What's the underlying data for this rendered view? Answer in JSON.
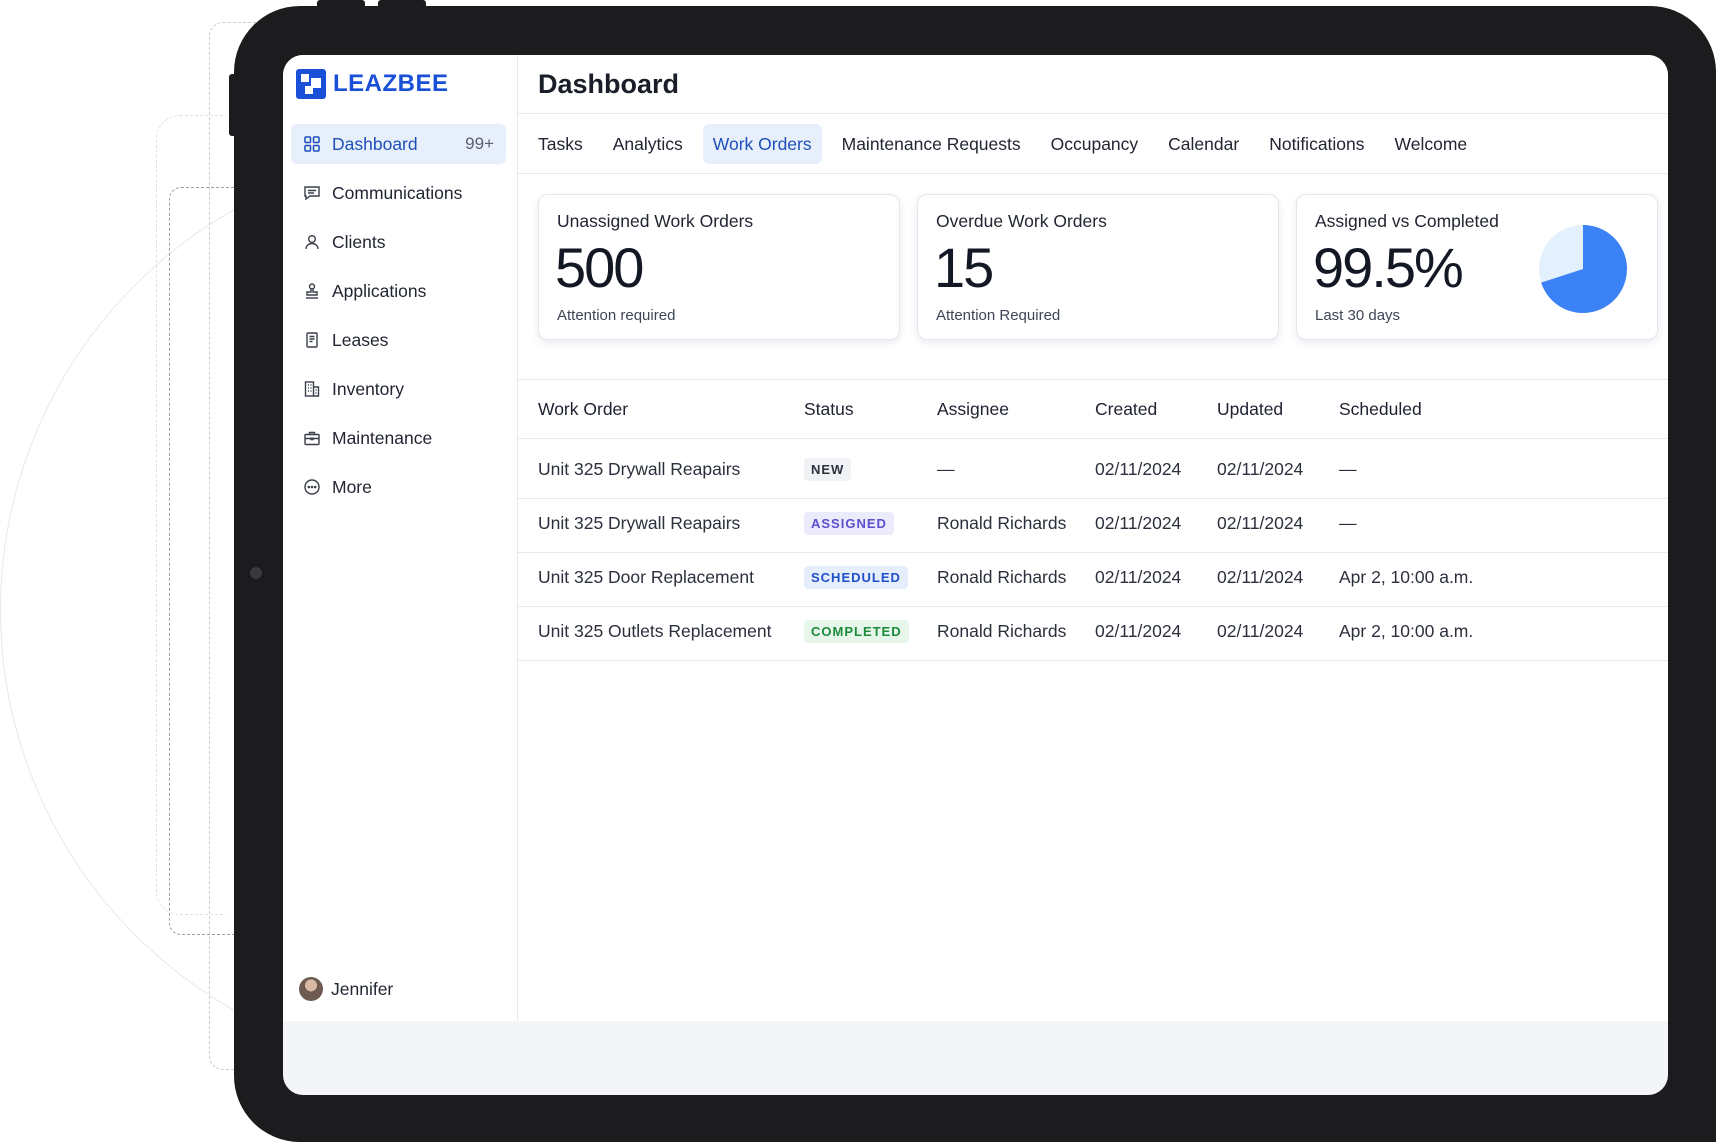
{
  "app": {
    "name": "LEAZBEE",
    "page_title": "Dashboard"
  },
  "sidebar": {
    "items": [
      {
        "label": "Dashboard",
        "icon": "grid-icon",
        "badge": "99+",
        "active": true
      },
      {
        "label": "Communications",
        "icon": "chat-icon"
      },
      {
        "label": "Clients",
        "icon": "user-icon"
      },
      {
        "label": "Applications",
        "icon": "stamp-icon"
      },
      {
        "label": "Leases",
        "icon": "document-icon"
      },
      {
        "label": "Inventory",
        "icon": "building-icon"
      },
      {
        "label": "Maintenance",
        "icon": "toolbox-icon"
      },
      {
        "label": "More",
        "icon": "more-icon"
      }
    ],
    "user": {
      "name": "Jennifer"
    }
  },
  "tabs": [
    {
      "label": "Tasks"
    },
    {
      "label": "Analytics"
    },
    {
      "label": "Work Orders",
      "active": true
    },
    {
      "label": "Maintenance Requests"
    },
    {
      "label": "Occupancy"
    },
    {
      "label": "Calendar"
    },
    {
      "label": "Notifications"
    },
    {
      "label": "Welcome"
    }
  ],
  "cards": [
    {
      "title": "Unassigned Work Orders",
      "value": "500",
      "sub": "Attention required"
    },
    {
      "title": "Overdue Work Orders",
      "value": "15",
      "sub": "Attention Required"
    },
    {
      "title": "Assigned vs Completed",
      "value": "99.5%",
      "sub": "Last 30 days",
      "pie_fraction": 0.7
    }
  ],
  "colors": {
    "accent": "#1a4fd8",
    "pie_fill": "#3b82f6",
    "pie_bg": "#e3f0fd"
  },
  "table": {
    "headers": [
      "Work Order",
      "Status",
      "Assignee",
      "Created",
      "Updated",
      "Scheduled"
    ],
    "rows": [
      {
        "work_order": "Unit 325 Drywall Reapairs",
        "status": "NEW",
        "assignee": "—",
        "created": "02/11/2024",
        "updated": "02/11/2024",
        "scheduled": "—"
      },
      {
        "work_order": "Unit 325 Drywall Reapairs",
        "status": "ASSIGNED",
        "assignee": "Ronald Richards",
        "created": "02/11/2024",
        "updated": "02/11/2024",
        "scheduled": "—"
      },
      {
        "work_order": "Unit 325 Door Replacement",
        "status": "SCHEDULED",
        "assignee": "Ronald Richards",
        "created": "02/11/2024",
        "updated": "02/11/2024",
        "scheduled": "Apr 2, 10:00 a.m."
      },
      {
        "work_order": "Unit 325 Outlets Replacement",
        "status": "COMPLETED",
        "assignee": "Ronald Richards",
        "created": "02/11/2024",
        "updated": "02/11/2024",
        "scheduled": "Apr 2, 10:00 a.m."
      }
    ]
  }
}
